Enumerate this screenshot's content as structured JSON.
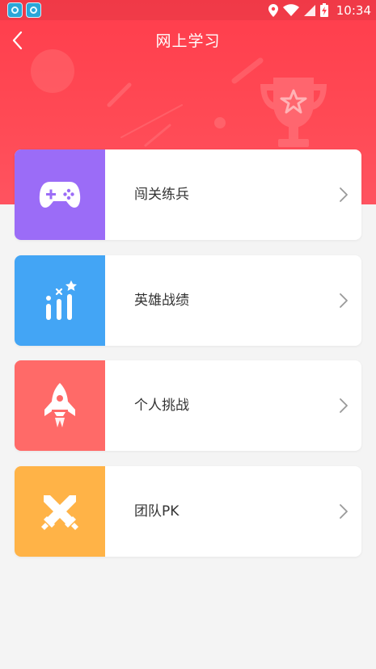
{
  "status_bar": {
    "time": "10:34",
    "icons": [
      "app-notification-icon",
      "app-notification-icon",
      "location-icon",
      "wifi-icon",
      "signal-icon",
      "battery-charging-icon"
    ]
  },
  "header": {
    "title": "网上学习",
    "back_icon": "chevron-left-icon",
    "decoration_icon": "trophy-icon"
  },
  "menu": {
    "items": [
      {
        "label": "闯关练兵",
        "icon": "gamepad-icon",
        "color": "#9b6cf7"
      },
      {
        "label": "英雄战绩",
        "icon": "ranking-bars-icon",
        "color": "#43a5f5"
      },
      {
        "label": "个人挑战",
        "icon": "rocket-icon",
        "color": "#ff6a68"
      },
      {
        "label": "团队PK",
        "icon": "crossed-swords-icon",
        "color": "#ffb347"
      }
    ]
  },
  "colors": {
    "header_red": "#ff4150",
    "background": "#f4f4f4",
    "text": "#333333"
  }
}
